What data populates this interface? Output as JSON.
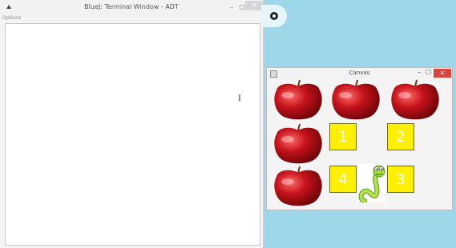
{
  "terminal": {
    "title": "BlueJ: Terminal Window - ADT",
    "menu": "Options",
    "controls": {
      "minimize": "–",
      "maximize": "☐",
      "close": "✕"
    },
    "cursor": "I"
  },
  "canvas_window": {
    "title": "Canvas",
    "controls": {
      "minimize": "–",
      "maximize": "☐",
      "close": "✕"
    },
    "tiles": [
      {
        "label": "1"
      },
      {
        "label": "2"
      },
      {
        "label": "4"
      },
      {
        "label": "3"
      }
    ],
    "colors": {
      "tile": "#ffef00",
      "apple": "#b3141c"
    }
  }
}
